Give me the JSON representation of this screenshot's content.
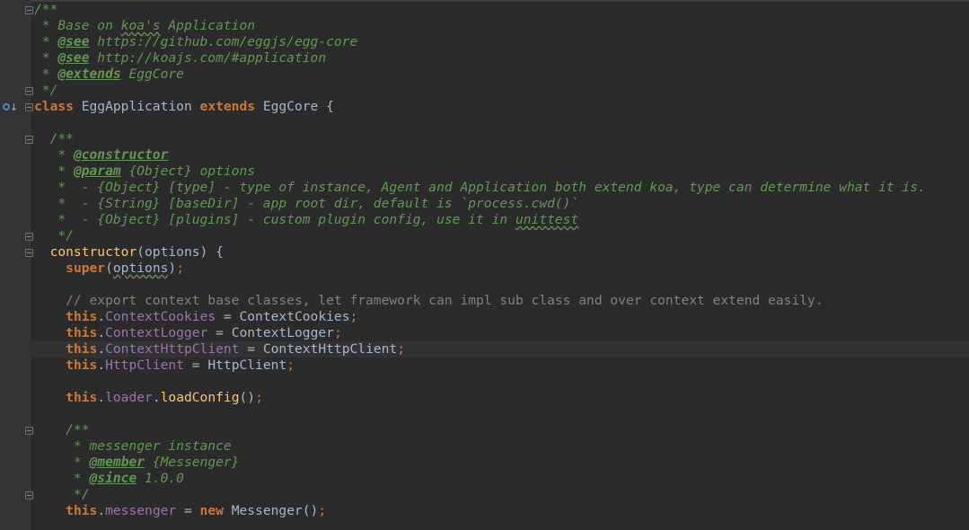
{
  "editor": {
    "theme_colors": {
      "background": "#2b2b2b",
      "gutter": "#313335",
      "keyword": "#cc7832",
      "doc_comment": "#629755",
      "comment": "#808080",
      "function": "#ffc66d",
      "property": "#9876aa",
      "text": "#a9b7c6"
    },
    "gutter_icons": [
      "override-icon",
      "intention-bulb-icon"
    ],
    "lines": [
      [
        {
          "t": "/**",
          "c": "doc"
        }
      ],
      [
        {
          "t": " * Base on ",
          "c": "doc"
        },
        {
          "t": "koa's",
          "c": "spell"
        },
        {
          "t": " Application",
          "c": "doc"
        }
      ],
      [
        {
          "t": " * ",
          "c": "doc"
        },
        {
          "t": "@see",
          "c": "doctag"
        },
        {
          "t": " https://github.com/eggjs/egg-core",
          "c": "doc"
        }
      ],
      [
        {
          "t": " * ",
          "c": "doc"
        },
        {
          "t": "@see",
          "c": "doctag"
        },
        {
          "t": " http://koajs.com/#application",
          "c": "doc"
        }
      ],
      [
        {
          "t": " * ",
          "c": "doc"
        },
        {
          "t": "@extends",
          "c": "doctag"
        },
        {
          "t": " EggCore",
          "c": "doc"
        }
      ],
      [
        {
          "t": " */",
          "c": "doc"
        }
      ],
      [
        {
          "t": "class",
          "c": "kw"
        },
        {
          "t": " EggApplication ",
          "c": "plain"
        },
        {
          "t": "extends",
          "c": "kw"
        },
        {
          "t": " EggCore {",
          "c": "plain"
        }
      ],
      [],
      [
        {
          "t": "  /**",
          "c": "doc"
        }
      ],
      [
        {
          "t": "   * ",
          "c": "doc"
        },
        {
          "t": "@constructor",
          "c": "doctag"
        }
      ],
      [
        {
          "t": "   * ",
          "c": "doc"
        },
        {
          "t": "@param",
          "c": "doctag"
        },
        {
          "t": " {Object} options",
          "c": "doctype"
        }
      ],
      [
        {
          "t": "   *  - {Object} [type] - type of instance, Agent and Application both extend koa, type can determine what it is.",
          "c": "doc"
        }
      ],
      [
        {
          "t": "   *  - {String} [baseDir] - app root dir, default is `process.cwd()`",
          "c": "doc"
        }
      ],
      [
        {
          "t": "   *  - {Object} [plugins] - custom plugin config, use it in ",
          "c": "doc"
        },
        {
          "t": "unittest",
          "c": "spell"
        }
      ],
      [
        {
          "t": "   */",
          "c": "doc"
        }
      ],
      [
        {
          "t": "  ",
          "c": "plain"
        },
        {
          "t": "constructor",
          "c": "fn"
        },
        {
          "t": "(options) {",
          "c": "plain"
        }
      ],
      [
        {
          "t": "    ",
          "c": "plain"
        },
        {
          "t": "super",
          "c": "kw"
        },
        {
          "t": "(",
          "c": "plain"
        },
        {
          "t": "options",
          "c": "param"
        },
        {
          "t": ")",
          "c": "plain"
        },
        {
          "t": ";",
          "c": "punc"
        }
      ],
      [],
      [
        {
          "t": "    // export context base classes, let framework can impl sub class and over context extend easily.",
          "c": "cmt"
        }
      ],
      [
        {
          "t": "    ",
          "c": "plain"
        },
        {
          "t": "this",
          "c": "kw"
        },
        {
          "t": ".",
          "c": "plain"
        },
        {
          "t": "ContextCookies",
          "c": "prop"
        },
        {
          "t": " = ContextCookies",
          "c": "plain"
        },
        {
          "t": ";",
          "c": "punc"
        }
      ],
      [
        {
          "t": "    ",
          "c": "plain"
        },
        {
          "t": "this",
          "c": "kw"
        },
        {
          "t": ".",
          "c": "plain"
        },
        {
          "t": "ContextLogger",
          "c": "prop"
        },
        {
          "t": " = ContextLogger",
          "c": "plain"
        },
        {
          "t": ";",
          "c": "punc"
        }
      ],
      [
        {
          "t": "    ",
          "c": "plain"
        },
        {
          "t": "this",
          "c": "kw"
        },
        {
          "t": ".",
          "c": "plain"
        },
        {
          "t": "ContextHttpClient",
          "c": "prop"
        },
        {
          "t": " = ContextHttpClient",
          "c": "plain"
        },
        {
          "t": ";",
          "c": "punc"
        }
      ],
      [
        {
          "t": "    ",
          "c": "plain"
        },
        {
          "t": "this",
          "c": "kw"
        },
        {
          "t": ".",
          "c": "plain"
        },
        {
          "t": "HttpClient",
          "c": "prop"
        },
        {
          "t": " = HttpClient",
          "c": "plain"
        },
        {
          "t": ";",
          "c": "punc"
        }
      ],
      [],
      [
        {
          "t": "    ",
          "c": "plain"
        },
        {
          "t": "this",
          "c": "kw"
        },
        {
          "t": ".",
          "c": "plain"
        },
        {
          "t": "loader",
          "c": "prop"
        },
        {
          "t": ".",
          "c": "plain"
        },
        {
          "t": "loadConfig",
          "c": "fn"
        },
        {
          "t": "()",
          "c": "plain"
        },
        {
          "t": ";",
          "c": "punc"
        }
      ],
      [],
      [
        {
          "t": "    /**",
          "c": "doc"
        }
      ],
      [
        {
          "t": "     * messenger instance",
          "c": "doc"
        }
      ],
      [
        {
          "t": "     * ",
          "c": "doc"
        },
        {
          "t": "@member",
          "c": "doctag"
        },
        {
          "t": " {Messenger}",
          "c": "doctype"
        }
      ],
      [
        {
          "t": "     * ",
          "c": "doc"
        },
        {
          "t": "@since",
          "c": "doctag"
        },
        {
          "t": " 1.0.0",
          "c": "doc"
        }
      ],
      [
        {
          "t": "     */",
          "c": "doc"
        }
      ],
      [
        {
          "t": "    ",
          "c": "plain"
        },
        {
          "t": "this",
          "c": "kw"
        },
        {
          "t": ".",
          "c": "plain"
        },
        {
          "t": "messenger",
          "c": "prop"
        },
        {
          "t": " = ",
          "c": "plain"
        },
        {
          "t": "new",
          "c": "kw"
        },
        {
          "t": " Messenger()",
          "c": "plain"
        },
        {
          "t": ";",
          "c": "punc"
        }
      ]
    ]
  }
}
